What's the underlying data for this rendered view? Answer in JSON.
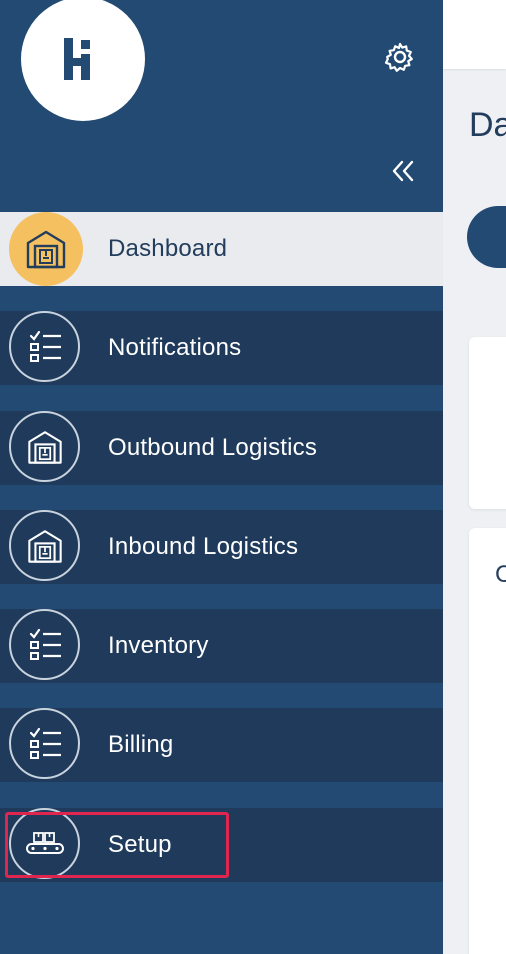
{
  "brand": {
    "logo_text": "Hi"
  },
  "sidebar": {
    "items": [
      {
        "label": "Dashboard",
        "icon": "warehouse-icon"
      },
      {
        "label": "Notifications",
        "icon": "checklist-icon"
      },
      {
        "label": "Outbound Logistics",
        "icon": "warehouse-icon"
      },
      {
        "label": "Inbound Logistics",
        "icon": "warehouse-icon"
      },
      {
        "label": "Inventory",
        "icon": "checklist-icon"
      },
      {
        "label": "Billing",
        "icon": "checklist-icon"
      },
      {
        "label": "Setup",
        "icon": "conveyor-icon"
      }
    ],
    "active_index": 0
  },
  "main": {
    "page_title": "Da",
    "card_text": "C"
  },
  "colors": {
    "sidebar_bg": "#234a72",
    "item_bg": "#1f3a5b",
    "active_bg": "#e9ebee",
    "active_icon_bg": "#f5c05f",
    "highlight": "#e0264f"
  }
}
